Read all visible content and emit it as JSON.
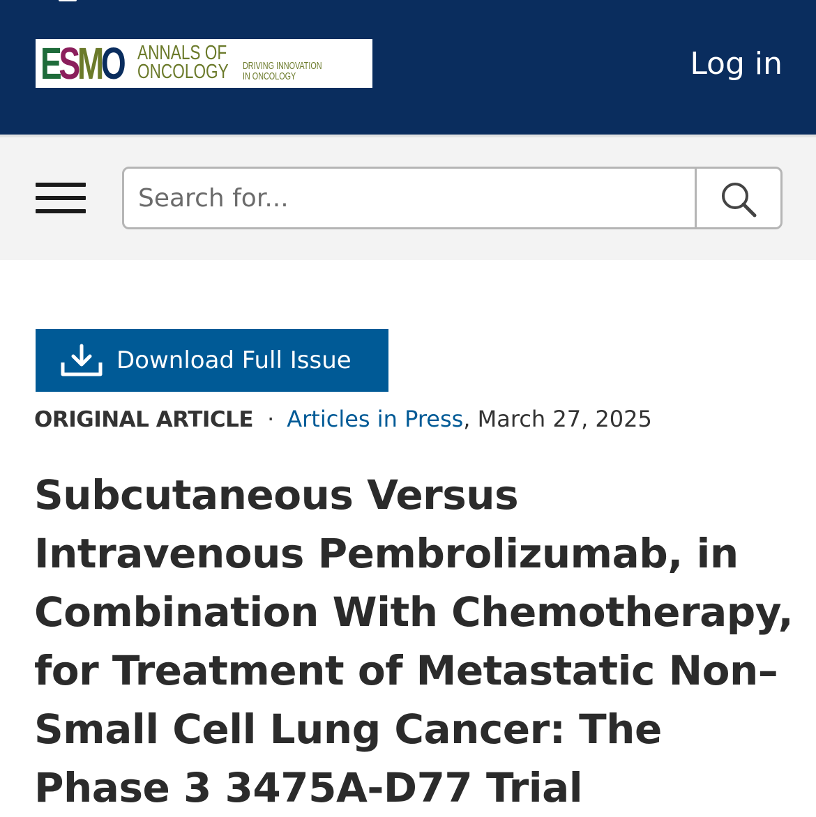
{
  "header": {
    "logo": {
      "esmo_letters": [
        "E",
        "S",
        "M",
        "O"
      ],
      "journal_line1": "ANNALS OF",
      "journal_line2": "ONCOLOGY",
      "tagline_line1": "DRIVING INNOVATION",
      "tagline_line2": "IN ONCOLOGY",
      "esmo_colors": [
        "#1e6b3a",
        "#8b1e5c",
        "#6b7a2a",
        "#0a2d5e"
      ],
      "text_color": "#6b7a2a"
    },
    "login_label": "Log in",
    "background_color": "#0a2d5e"
  },
  "toolbar": {
    "menu_icon": "hamburger-menu-icon",
    "search": {
      "placeholder": "Search for...",
      "value": "",
      "button_icon": "search-icon"
    }
  },
  "article": {
    "download_button": {
      "label": "Download Full Issue",
      "icon": "download-icon",
      "color": "#005a96"
    },
    "meta": {
      "type": "ORIGINAL ARTICLE",
      "separator": "·",
      "section_link": "Articles in Press",
      "date": ", March 27, 2025"
    },
    "title": "Subcutaneous Versus Intravenous Pembrolizumab, in Combination With Chemotherapy, for Treatment of Metastatic Non–Small Cell Lung Cancer: The Phase 3 3475A-D77 Trial"
  }
}
